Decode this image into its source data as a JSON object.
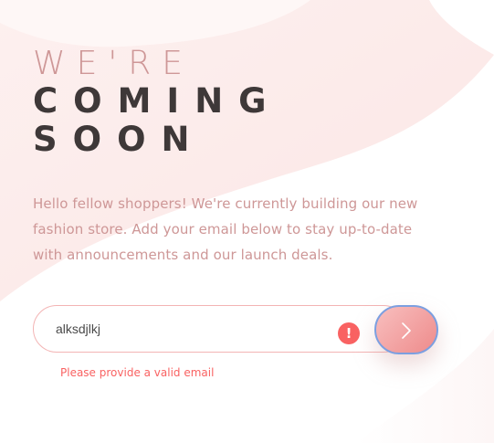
{
  "heading": {
    "line1": "WE'RE",
    "line2": "COMING",
    "line3": "SOON"
  },
  "intro_text": "Hello fellow shoppers! We're currently building our new fashion store. Add your email below to stay up-to-date with announcements and our launch deals.",
  "form": {
    "email_value": "alksdjlkj",
    "error_icon_glyph": "!",
    "error_message": "Please provide a valid email",
    "submit_icon": "chevron-right-icon"
  },
  "colors": {
    "accent_text": "#ce9797",
    "heading_dark": "#3e3838",
    "error": "#f96262",
    "input_border": "#f3b4b4",
    "button_gradient_start": "#f8bfbf",
    "button_gradient_end": "#ee8b8b",
    "focus_ring": "#7c9fe0"
  }
}
